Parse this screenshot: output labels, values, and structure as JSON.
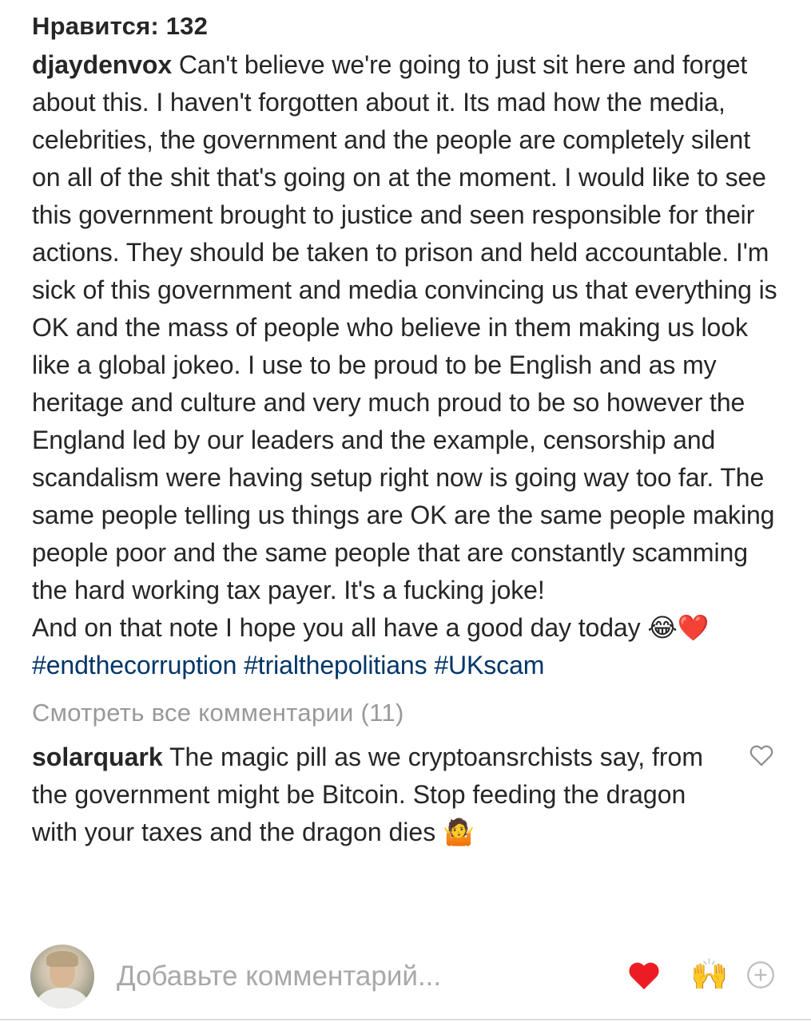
{
  "post": {
    "likes_text": "Нравится: 132",
    "caption": {
      "username": "djaydenvox",
      "text": "Can't believe we're going to just sit here and forget about this. I haven't forgotten about it. Its mad how the media, celebrities, the government and the people are completely silent on all of the shit that's going on at the moment. I would like to see this government brought to justice and seen responsible for their actions. They should be taken to prison and held accountable. I'm sick of this government and media convincing us that everything is OK and the mass of people who believe in them making us look like a global jokeo. I use to be proud to be English and as my heritage and culture and very much proud to be so however the England led by our leaders and the example, censorship and scandalism were having setup right now is going way too far. The same people telling us things are OK are the same people making people poor and the same people that are constantly scamming the hard working tax payer. It's a fucking joke!",
      "second_line": "And on that note I hope you all have a good day today",
      "second_line_emoji": "😂❤️",
      "hashtags": [
        "#endthecorruption",
        "#trialthepolitians",
        "#UKscam"
      ]
    },
    "view_comments_text": "Смотреть все комментарии (11)",
    "comments": [
      {
        "username": "solarquark",
        "text": "The magic pill as we cryptoansrchists say, from the government might be Bitcoin. Stop feeding the dragon with your taxes and the dragon dies",
        "emoji": "🤷",
        "like_icon": "heart-outline-icon"
      }
    ]
  },
  "composer": {
    "placeholder": "Добавьте комментарий...",
    "quick_reactions": [
      {
        "icon": "red-heart-icon",
        "glyph": "❤️"
      },
      {
        "icon": "raising-hands-icon",
        "glyph": "🙌"
      },
      {
        "icon": "plus-circle-icon",
        "glyph": "⊕"
      }
    ]
  },
  "colors": {
    "text": "#262626",
    "secondary_text": "#999999",
    "hashtag": "#003569",
    "placeholder": "#a8a8a8",
    "heart_red": "#ed1c24",
    "divider": "#dbdbdb"
  }
}
